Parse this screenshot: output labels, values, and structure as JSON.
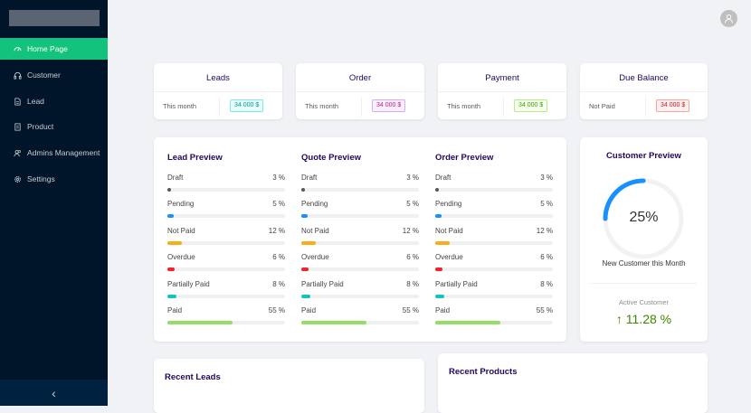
{
  "sidebar": {
    "items": [
      {
        "label": "Home Page",
        "icon": "dashboard-icon"
      },
      {
        "label": "Customer",
        "icon": "customer-icon"
      },
      {
        "label": "Lead",
        "icon": "file-icon"
      },
      {
        "label": "Product",
        "icon": "product-icon"
      },
      {
        "label": "Admins Management",
        "icon": "team-icon"
      },
      {
        "label": "Settings",
        "icon": "gear-icon"
      }
    ],
    "collapse_glyph": "‹"
  },
  "stats": [
    {
      "title": "Leads",
      "label": "This month",
      "value": "34 000 $",
      "color": "#08979c",
      "bg": "#e6fffb",
      "border": "#87e8de"
    },
    {
      "title": "Order",
      "label": "This month",
      "value": "34 000 $",
      "color": "#c41d7f",
      "bg": "#f9f0ff",
      "border": "#d3adf7"
    },
    {
      "title": "Payment",
      "label": "This month",
      "value": "34 000 $",
      "color": "#389e0d",
      "bg": "#f6ffed",
      "border": "#b7eb8f"
    },
    {
      "title": "Due Balance",
      "label": "Not Paid",
      "value": "34 000 $",
      "color": "#cf1322",
      "bg": "#fff1f0",
      "border": "#ffa39e"
    }
  ],
  "previews": [
    {
      "title": "Lead Preview",
      "rows": [
        {
          "label": "Draft",
          "pct": "3 %",
          "value": 3,
          "color": "#595959"
        },
        {
          "label": "Pending",
          "pct": "5 %",
          "value": 5,
          "color": "#1890ff"
        },
        {
          "label": "Not Paid",
          "pct": "12 %",
          "value": 12,
          "color": "#faad14"
        },
        {
          "label": "Overdue",
          "pct": "6 %",
          "value": 6,
          "color": "#f5222d"
        },
        {
          "label": "Partially Paid",
          "pct": "8 %",
          "value": 8,
          "color": "#13c2c2"
        },
        {
          "label": "Paid",
          "pct": "55 %",
          "value": 55,
          "color": "#95de64"
        }
      ]
    },
    {
      "title": "Quote Preview",
      "rows": [
        {
          "label": "Draft",
          "pct": "3 %",
          "value": 3,
          "color": "#595959"
        },
        {
          "label": "Pending",
          "pct": "5 %",
          "value": 5,
          "color": "#1890ff"
        },
        {
          "label": "Not Paid",
          "pct": "12 %",
          "value": 12,
          "color": "#faad14"
        },
        {
          "label": "Overdue",
          "pct": "6 %",
          "value": 6,
          "color": "#f5222d"
        },
        {
          "label": "Partially Paid",
          "pct": "8 %",
          "value": 8,
          "color": "#13c2c2"
        },
        {
          "label": "Paid",
          "pct": "55 %",
          "value": 55,
          "color": "#95de64"
        }
      ]
    },
    {
      "title": "Order Preview",
      "rows": [
        {
          "label": "Draft",
          "pct": "3 %",
          "value": 3,
          "color": "#595959"
        },
        {
          "label": "Pending",
          "pct": "5 %",
          "value": 5,
          "color": "#1890ff"
        },
        {
          "label": "Not Paid",
          "pct": "12 %",
          "value": 12,
          "color": "#faad14"
        },
        {
          "label": "Overdue",
          "pct": "6 %",
          "value": 6,
          "color": "#f5222d"
        },
        {
          "label": "Partially Paid",
          "pct": "8 %",
          "value": 8,
          "color": "#13c2c2"
        },
        {
          "label": "Paid",
          "pct": "55 %",
          "value": 55,
          "color": "#95de64"
        }
      ]
    }
  ],
  "customer": {
    "title": "Customer Preview",
    "percent": "25%",
    "percent_value": 25,
    "gauge_color": "#1890ff",
    "subtitle": "New Customer this Month",
    "active_label": "Active Customer",
    "active_value": "11.28 %",
    "active_color": "#3f8600"
  },
  "recent": {
    "leads_title": "Recent Leads",
    "products_title": "Recent Products"
  }
}
